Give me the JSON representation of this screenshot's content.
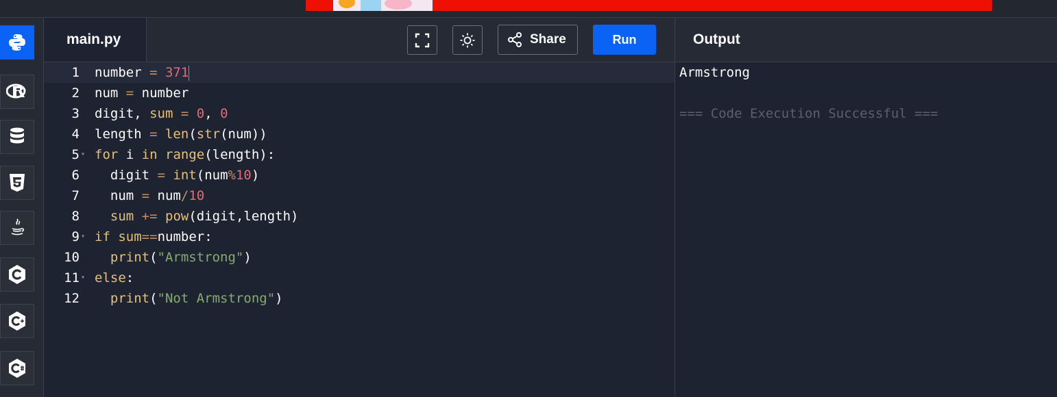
{
  "header": {
    "tab_label": "main.py",
    "share_label": "Share",
    "run_label": "Run"
  },
  "sidebar": {
    "languages": [
      "Python",
      "R",
      "SQL",
      "HTML5",
      "Java",
      "C",
      "C++",
      "C#"
    ],
    "active": "Python",
    "accent": "#0b63f6"
  },
  "editor": {
    "line_numbers": [
      "1",
      "2",
      "3",
      "4",
      "5",
      "6",
      "7",
      "8",
      "9",
      "10",
      "11",
      "12"
    ],
    "lines": [
      "number = 371",
      "num = number",
      "digit, sum = 0, 0",
      "length = len(str(num))",
      "for i in range(length):",
      "  digit = int(num%10)",
      "  num = num/10",
      "  sum += pow(digit,length)",
      "if sum==number:",
      "  print(\"Armstrong\")",
      "else:",
      "  print(\"Not Armstrong\")"
    ]
  },
  "output": {
    "title": "Output",
    "result": "Armstrong",
    "status": "=== Code Execution Successful ==="
  }
}
